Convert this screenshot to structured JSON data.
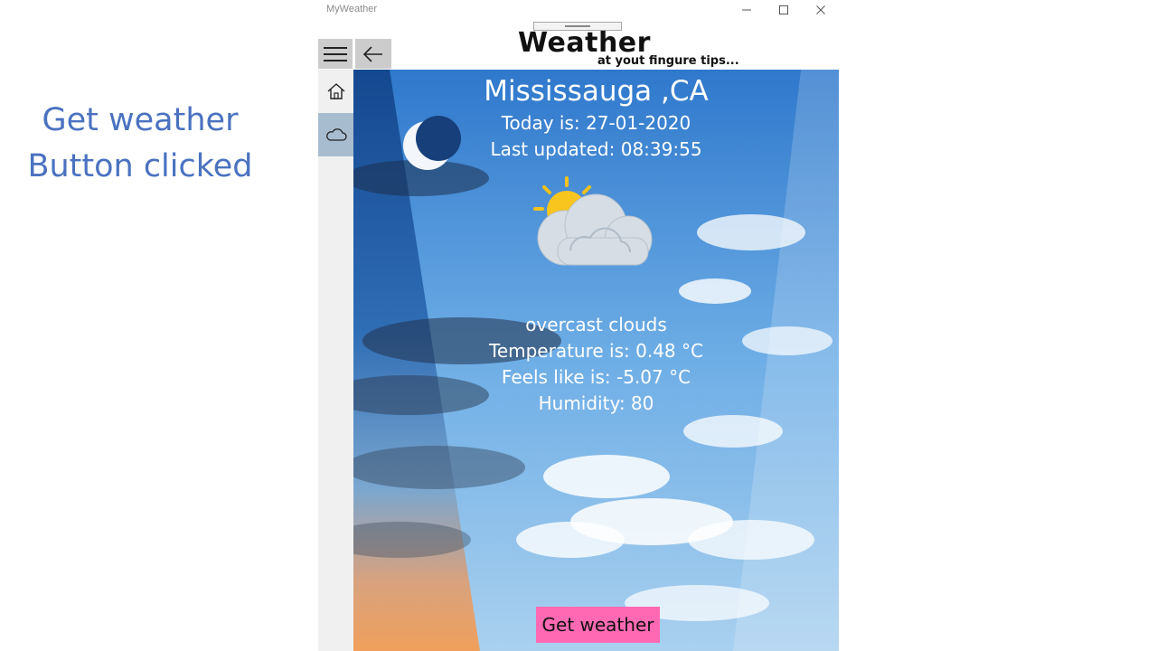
{
  "annotation": {
    "line1": "Get weather",
    "line2": "Button clicked"
  },
  "window": {
    "title": "MyWeather"
  },
  "header": {
    "title": "Weather",
    "tagline": "at yout fingure tips..."
  },
  "nav": {
    "items": [
      {
        "icon": "home-icon"
      },
      {
        "icon": "cloud-icon",
        "selected": true
      }
    ]
  },
  "weather": {
    "city": "Mississauga ,CA",
    "date": "Today is: 27-01-2020",
    "updated": "Last updated: 08:39:55",
    "icon": "partly-cloudy-icon",
    "description": "overcast clouds",
    "temperature": "Temperature is: 0.48 °C",
    "feels_like": "Feels like is: -5.07 °C",
    "humidity": "Humidity: 80"
  },
  "actions": {
    "get_weather_label": "Get weather"
  },
  "colors": {
    "annotation": "#4a72c0",
    "button": "#ff69b4",
    "nav_selected": "#a8bccf"
  }
}
